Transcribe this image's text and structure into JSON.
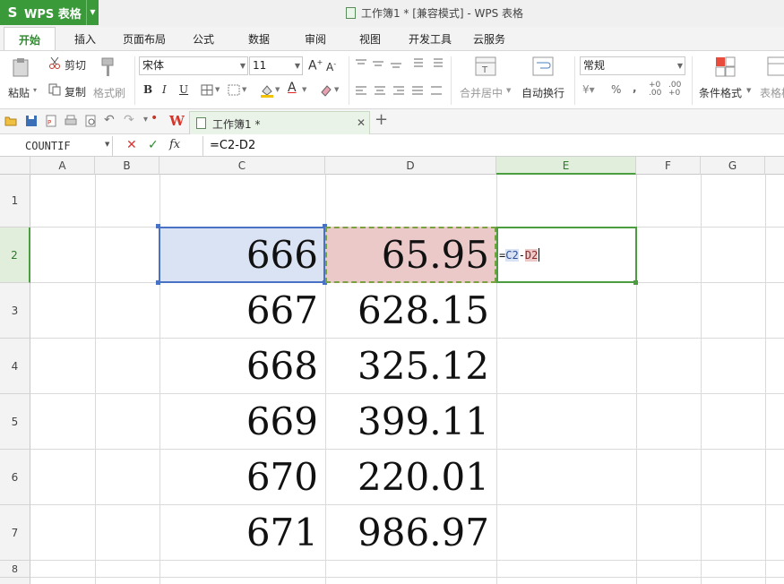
{
  "app": {
    "name": "WPS 表格"
  },
  "window": {
    "title": "工作簿1 * [兼容模式] - WPS 表格"
  },
  "menu_tabs": [
    "开始",
    "插入",
    "页面布局",
    "公式",
    "数据",
    "审阅",
    "视图",
    "开发工具",
    "云服务"
  ],
  "active_tab": "开始",
  "ribbon": {
    "paste": "粘贴",
    "cut": "剪切",
    "copy": "复制",
    "format_painter": "格式刷",
    "font_name": "宋体",
    "font_size": "11",
    "merge_center": "合并居中",
    "wrap_text": "自动换行",
    "number_format": "常规",
    "conditional_format": "条件格式",
    "table_style": "表格样"
  },
  "doc_tab": {
    "title": "工作簿1 *"
  },
  "formula_bar": {
    "name_box": "COUNTIF",
    "formula": "=C2-D2",
    "fx_label": "fx"
  },
  "columns": [
    "A",
    "B",
    "C",
    "D",
    "E",
    "F",
    "G"
  ],
  "rows": [
    "1",
    "2",
    "3",
    "4",
    "5",
    "6",
    "7",
    "8"
  ],
  "cells": {
    "C": [
      "",
      "666",
      "667",
      "668",
      "669",
      "670",
      "671"
    ],
    "D": [
      "",
      "65.95",
      "628.15",
      "325.12",
      "399.11",
      "220.01",
      "986.97"
    ]
  },
  "editing_cell": {
    "address": "E2",
    "eq": "=",
    "ref1": "C2",
    "op": "-",
    "ref2": "D2"
  },
  "colors": {
    "accent": "#3a9a3a",
    "ref1_bg": "#dae3f3",
    "ref2_bg": "#ecc9c9",
    "active_border": "#4c9d3f"
  }
}
